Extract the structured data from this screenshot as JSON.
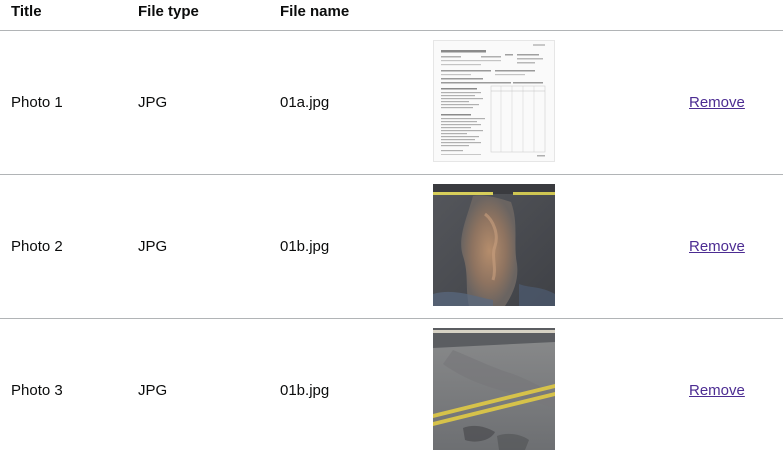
{
  "table": {
    "headers": {
      "title": "Title",
      "file_type": "File type",
      "file_name": "File name"
    },
    "rows": [
      {
        "title": "Photo 1",
        "file_type": "JPG",
        "file_name": "01a.jpg",
        "action": "Remove",
        "thumbnail": "document-scan-thumbnail"
      },
      {
        "title": "Photo 2",
        "file_type": "JPG",
        "file_name": "01b.jpg",
        "action": "Remove",
        "thumbnail": "road-patch-thumbnail"
      },
      {
        "title": "Photo 3",
        "file_type": "JPG",
        "file_name": "01b.jpg",
        "action": "Remove",
        "thumbnail": "road-markings-thumbnail"
      }
    ]
  },
  "colors": {
    "text": "#0b0c0c",
    "link": "#4c2c92",
    "border": "#b1b4b6"
  }
}
